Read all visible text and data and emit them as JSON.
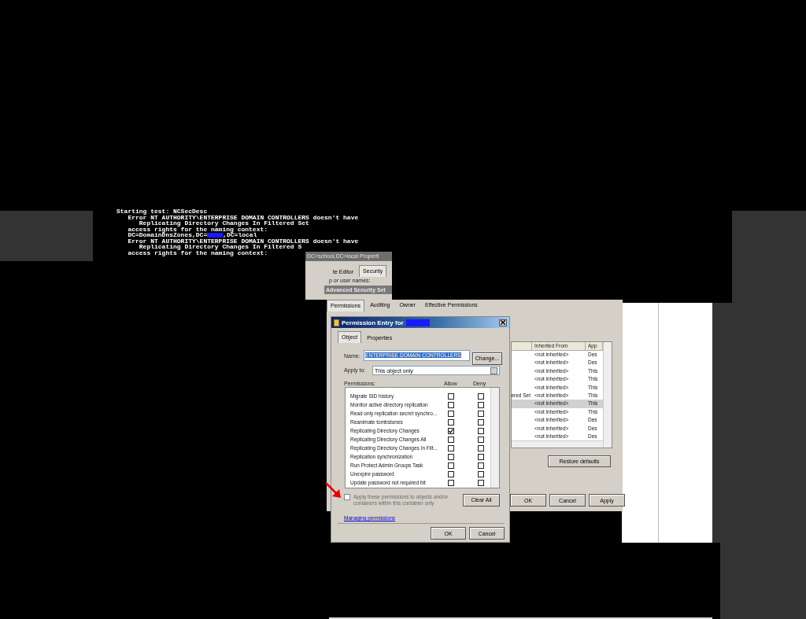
{
  "console": {
    "lines": [
      {
        "text": "Starting test: NCSecDesc"
      },
      {
        "text": "   Error NT AUTHORITY\\ENTERPRISE DOMAIN CONTROLLERS doesn't have"
      },
      {
        "text": "      Replicating Directory Changes In Filtered Set"
      },
      {
        "text": "   access rights for the naming context:"
      },
      {
        "text": "   DC=DomainDnsZones,DC=",
        "redacted": true,
        "after": ",DC=local"
      },
      {
        "text": "   Error NT AUTHORITY\\ENTERPRISE DOMAIN CONTROLLERS doesn't have"
      },
      {
        "text": "      Replicating Directory Changes In Filtered S"
      },
      {
        "text": "   access rights for the naming context:"
      }
    ]
  },
  "properties_window": {
    "title": "DC=school,DC=local Properti",
    "tabs": [
      {
        "label": "te Editor",
        "selected": false
      },
      {
        "label": "Security",
        "selected": true
      }
    ],
    "caption": "p or user names:"
  },
  "advanced_window": {
    "title": "Advanced Security Set",
    "tabs": [
      {
        "label": "Permissions",
        "selected": true
      },
      {
        "label": "Auditing",
        "selected": false
      },
      {
        "label": "Owner",
        "selected": false
      },
      {
        "label": "Effective Permissions",
        "selected": false
      }
    ],
    "columns": [
      "Inherited From",
      "App"
    ],
    "rows": [
      {
        "permission": "",
        "inherited": "<not inherited>",
        "applies": "Des",
        "selected": false
      },
      {
        "permission": "",
        "inherited": "<not inherited>",
        "applies": "Des",
        "selected": false
      },
      {
        "permission": "",
        "inherited": "<not inherited>",
        "applies": "This",
        "selected": false
      },
      {
        "permission": "",
        "inherited": "<not inherited>",
        "applies": "This",
        "selected": false
      },
      {
        "permission": "",
        "inherited": "<not inherited>",
        "applies": "This",
        "selected": false
      },
      {
        "permission": "ered Set",
        "inherited": "<not inherited>",
        "applies": "This",
        "selected": false
      },
      {
        "permission": "",
        "inherited": "<not inherited>",
        "applies": "This",
        "selected": true
      },
      {
        "permission": "",
        "inherited": "<not inherited>",
        "applies": "This",
        "selected": false
      },
      {
        "permission": "",
        "inherited": "<not inherited>",
        "applies": "Des",
        "selected": false
      },
      {
        "permission": "",
        "inherited": "<not inherited>",
        "applies": "Des",
        "selected": false
      },
      {
        "permission": "",
        "inherited": "<not inherited>",
        "applies": "Des",
        "selected": false
      }
    ],
    "restore_button": "Restore defaults",
    "buttons": [
      "OK",
      "Cancel",
      "Apply"
    ]
  },
  "permission_dialog": {
    "title": "Permission Entry for",
    "title_redacted": true,
    "tabs": [
      {
        "label": "Object",
        "selected": true
      },
      {
        "label": "Properties",
        "selected": false
      }
    ],
    "name_label": "Name:",
    "name_value": "ENTERPRISE DOMAIN CONTROLLERS",
    "change_button": "Change...",
    "apply_to_label": "Apply to:",
    "apply_to_value": "This object only",
    "permissions_label": "Permissions:",
    "allow_label": "Allow",
    "deny_label": "Deny",
    "permissions": [
      {
        "name": "Migrate SID history",
        "allow": false,
        "deny": false
      },
      {
        "name": "Monitor active directory replication",
        "allow": false,
        "deny": false
      },
      {
        "name": "Read only replication secret synchro...",
        "allow": false,
        "deny": false
      },
      {
        "name": "Reanimate tombstones",
        "allow": false,
        "deny": false
      },
      {
        "name": "Replicating Directory Changes",
        "allow": true,
        "deny": false
      },
      {
        "name": "Replicating Directory Changes All",
        "allow": false,
        "deny": false
      },
      {
        "name": "Replicating Directory Changes In Filt...",
        "allow": false,
        "deny": false
      },
      {
        "name": "Replication synchronization",
        "allow": false,
        "deny": false
      },
      {
        "name": "Run Protect Admin Groups Task",
        "allow": false,
        "deny": false
      },
      {
        "name": "Unexpire password",
        "allow": false,
        "deny": false
      },
      {
        "name": "Update password not required bit",
        "allow": false,
        "deny": false
      }
    ],
    "apply_inherit": {
      "label": "Apply these permissions to objects and/or containers within this container only",
      "checked": false,
      "disabled": true
    },
    "clear_button": "Clear All",
    "link": "Managing permissions",
    "buttons": [
      "OK",
      "Cancel"
    ]
  }
}
